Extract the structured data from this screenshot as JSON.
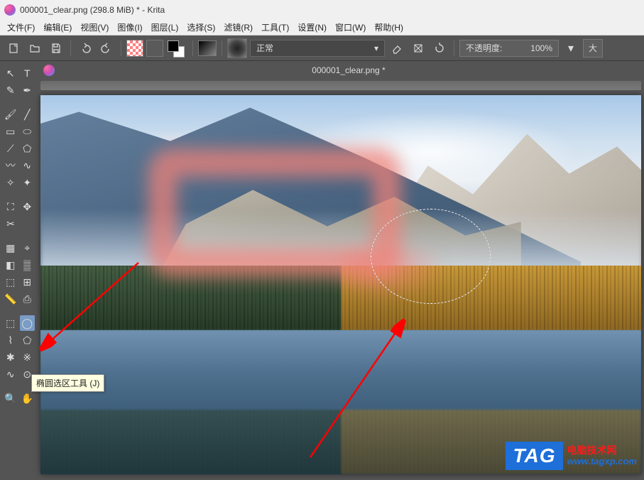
{
  "title": "000001_clear.png (298.8 MiB)  * - Krita",
  "menus": [
    "文件(F)",
    "编辑(E)",
    "视图(V)",
    "图像(I)",
    "图层(L)",
    "选择(S)",
    "滤镜(R)",
    "工具(T)",
    "设置(N)",
    "窗口(W)",
    "帮助(H)"
  ],
  "toolbar": {
    "blend_mode": "正常",
    "opacity_label": "不透明度:",
    "opacity_value": "100%",
    "big_button": "大"
  },
  "document_tab": "000001_clear.png *",
  "tooltip": "椭圆选区工具 (J)",
  "watermark": {
    "tag": "TAG",
    "line1": "电脑技术网",
    "line2": "www.tagxp.com"
  },
  "tools": {
    "move": "↖",
    "text": "T",
    "edit": "✎",
    "calligraphy": "✒",
    "brush": "🖌",
    "line": "╱",
    "rect": "▭",
    "ellipse": "⬭",
    "polyline": "⟋",
    "polygon": "⬠",
    "bezier": "〰",
    "freehand": "∿",
    "dynamic": "✧",
    "multibrush": "✦",
    "transform": "⛶",
    "move2": "✥",
    "crop": "✂",
    "fill": "▦",
    "picker": "⌖",
    "gradient": "◧",
    "pattern": "▒",
    "smartfill": "⬚",
    "assistant": "⊞",
    "measure": "📏",
    "reference": "⎙",
    "rectsel": "⬚",
    "ellipsesel": "◯",
    "freesel": "⌇",
    "polysel": "⬠",
    "contsel": "✱",
    "similarsel": "※",
    "beziersel": "∿",
    "magnetsel": "⊙",
    "zoom": "🔍",
    "pan": "✋"
  }
}
